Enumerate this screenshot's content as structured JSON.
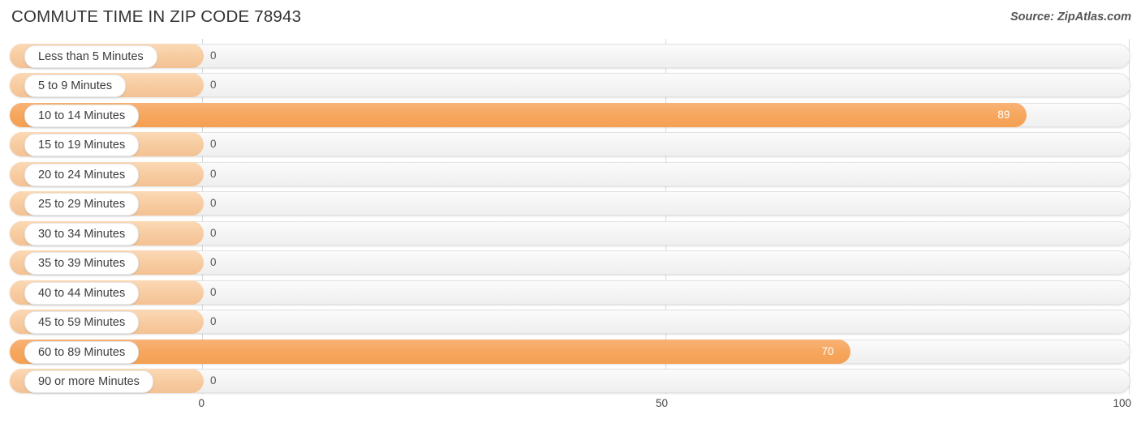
{
  "header": {
    "title": "COMMUTE TIME IN ZIP CODE 78943",
    "source": "Source: ZipAtlas.com"
  },
  "colors": {
    "bar_filled": "#f6a65c",
    "bar_zero": "#f7cba0",
    "track": "#f4f4f4",
    "gridline": "#d8d8d8",
    "title": "#333333",
    "value_outside": "#555555",
    "value_inside": "#ffffff"
  },
  "chart_data": {
    "type": "bar",
    "orientation": "horizontal",
    "title": "COMMUTE TIME IN ZIP CODE 78943",
    "subtitle": "Source: ZipAtlas.com",
    "xlabel": "",
    "ylabel": "",
    "xlim": [
      0,
      100
    ],
    "xticks": [
      0,
      50,
      100
    ],
    "xtick_labels": [
      "0",
      "50",
      "100"
    ],
    "grid": true,
    "legend": false,
    "categories": [
      "Less than 5 Minutes",
      "5 to 9 Minutes",
      "10 to 14 Minutes",
      "15 to 19 Minutes",
      "20 to 24 Minutes",
      "25 to 29 Minutes",
      "30 to 34 Minutes",
      "35 to 39 Minutes",
      "40 to 44 Minutes",
      "45 to 59 Minutes",
      "60 to 89 Minutes",
      "90 or more Minutes"
    ],
    "values": [
      0,
      0,
      89,
      0,
      0,
      0,
      0,
      0,
      0,
      0,
      70,
      0
    ],
    "value_labels": [
      "0",
      "0",
      "89",
      "0",
      "0",
      "0",
      "0",
      "0",
      "0",
      "0",
      "70",
      "0"
    ]
  }
}
